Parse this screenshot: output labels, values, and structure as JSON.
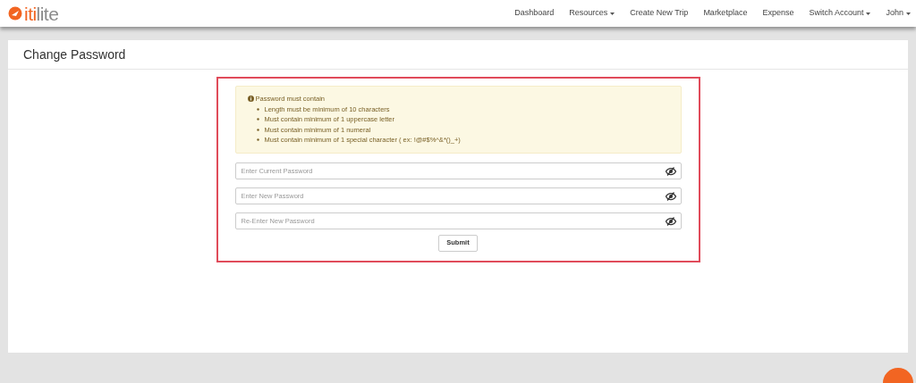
{
  "logo": {
    "prefix": "iti",
    "suffix": "lite"
  },
  "nav": [
    {
      "label": "Dashboard",
      "dropdown": false
    },
    {
      "label": "Resources",
      "dropdown": true
    },
    {
      "label": "Create New Trip",
      "dropdown": false
    },
    {
      "label": "Marketplace",
      "dropdown": false
    },
    {
      "label": "Expense",
      "dropdown": false
    },
    {
      "label": "Switch Account",
      "dropdown": true
    },
    {
      "label": "John",
      "dropdown": true
    }
  ],
  "page_title": "Change Password",
  "notice": {
    "title": "Password must contain",
    "rules": [
      "Length must be minimum of 10 characters",
      "Must contain minimum of 1 uppercase letter",
      "Must contain minimum of 1 numeral",
      "Must contain minimum of 1 special character ( ex: !@#$%^&*()_+)"
    ]
  },
  "fields": [
    {
      "placeholder": "Enter Current Password"
    },
    {
      "placeholder": "Enter New Password"
    },
    {
      "placeholder": "Re-Enter New Password"
    }
  ],
  "submit": "Submit"
}
